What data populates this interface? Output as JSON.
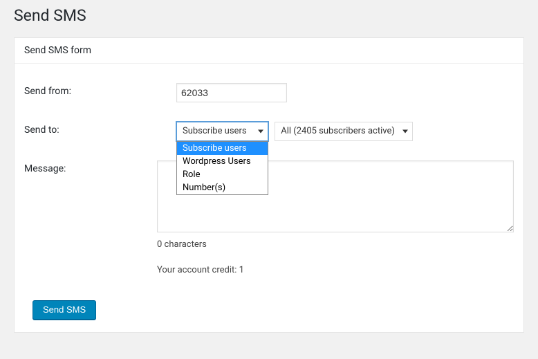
{
  "page": {
    "title": "Send SMS"
  },
  "panel": {
    "header": "Send SMS form"
  },
  "form": {
    "sendFrom": {
      "label": "Send from:",
      "value": "62033"
    },
    "sendTo": {
      "label": "Send to:",
      "selected": "Subscribe users",
      "options": [
        "Subscribe users",
        "Wordpress Users",
        "Role",
        "Number(s)"
      ],
      "secondary": {
        "selected": "All (2405 subscribers active)"
      }
    },
    "message": {
      "label": "Message:",
      "value": "",
      "charCount": "0 characters"
    },
    "credit": "Your account credit: 1",
    "submitLabel": "Send SMS"
  }
}
